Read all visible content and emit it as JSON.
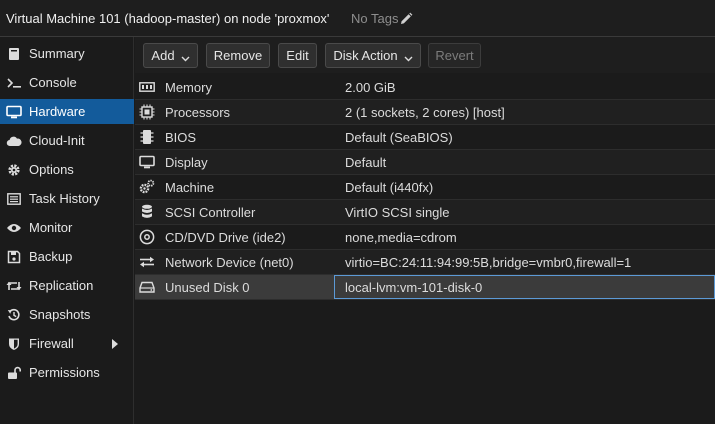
{
  "header": {
    "title": "Virtual Machine 101 (hadoop-master) on node 'proxmox'",
    "tags": "No Tags"
  },
  "sidebar": {
    "items": [
      {
        "label": "Summary",
        "icon": "book-icon"
      },
      {
        "label": "Console",
        "icon": "terminal-icon"
      },
      {
        "label": "Hardware",
        "icon": "desktop-icon",
        "active": true
      },
      {
        "label": "Cloud-Init",
        "icon": "cloud-icon"
      },
      {
        "label": "Options",
        "icon": "gear-icon"
      },
      {
        "label": "Task History",
        "icon": "list-icon"
      },
      {
        "label": "Monitor",
        "icon": "eye-icon"
      },
      {
        "label": "Backup",
        "icon": "floppy-icon"
      },
      {
        "label": "Replication",
        "icon": "retweet-icon"
      },
      {
        "label": "Snapshots",
        "icon": "history-icon"
      },
      {
        "label": "Firewall",
        "icon": "shield-icon"
      },
      {
        "label": "Permissions",
        "icon": "unlock-icon"
      }
    ]
  },
  "toolbar": {
    "add": "Add",
    "remove": "Remove",
    "edit": "Edit",
    "disk_action": "Disk Action",
    "revert": "Revert"
  },
  "hardware": {
    "rows": [
      {
        "name": "Memory",
        "value": "2.00 GiB",
        "icon": "memory-icon"
      },
      {
        "name": "Processors",
        "value": "2 (1 sockets, 2 cores) [host]",
        "icon": "cpu-icon"
      },
      {
        "name": "BIOS",
        "value": "Default (SeaBIOS)",
        "icon": "microchip-icon"
      },
      {
        "name": "Display",
        "value": "Default",
        "icon": "monitor-icon"
      },
      {
        "name": "Machine",
        "value": "Default (i440fx)",
        "icon": "cogs-icon"
      },
      {
        "name": "SCSI Controller",
        "value": "VirtIO SCSI single",
        "icon": "database-icon"
      },
      {
        "name": "CD/DVD Drive (ide2)",
        "value": "none,media=cdrom",
        "icon": "cdrom-icon"
      },
      {
        "name": "Network Device (net0)",
        "value": "virtio=BC:24:11:94:99:5B,bridge=vmbr0,firewall=1",
        "icon": "exchange-icon"
      },
      {
        "name": "Unused Disk 0",
        "value": "local-lvm:vm-101-disk-0",
        "icon": "hdd-icon",
        "selected": true
      }
    ]
  },
  "colors": {
    "accent": "#135b9b",
    "background": "#1b1b1b",
    "selection": "#3b3b3b"
  }
}
